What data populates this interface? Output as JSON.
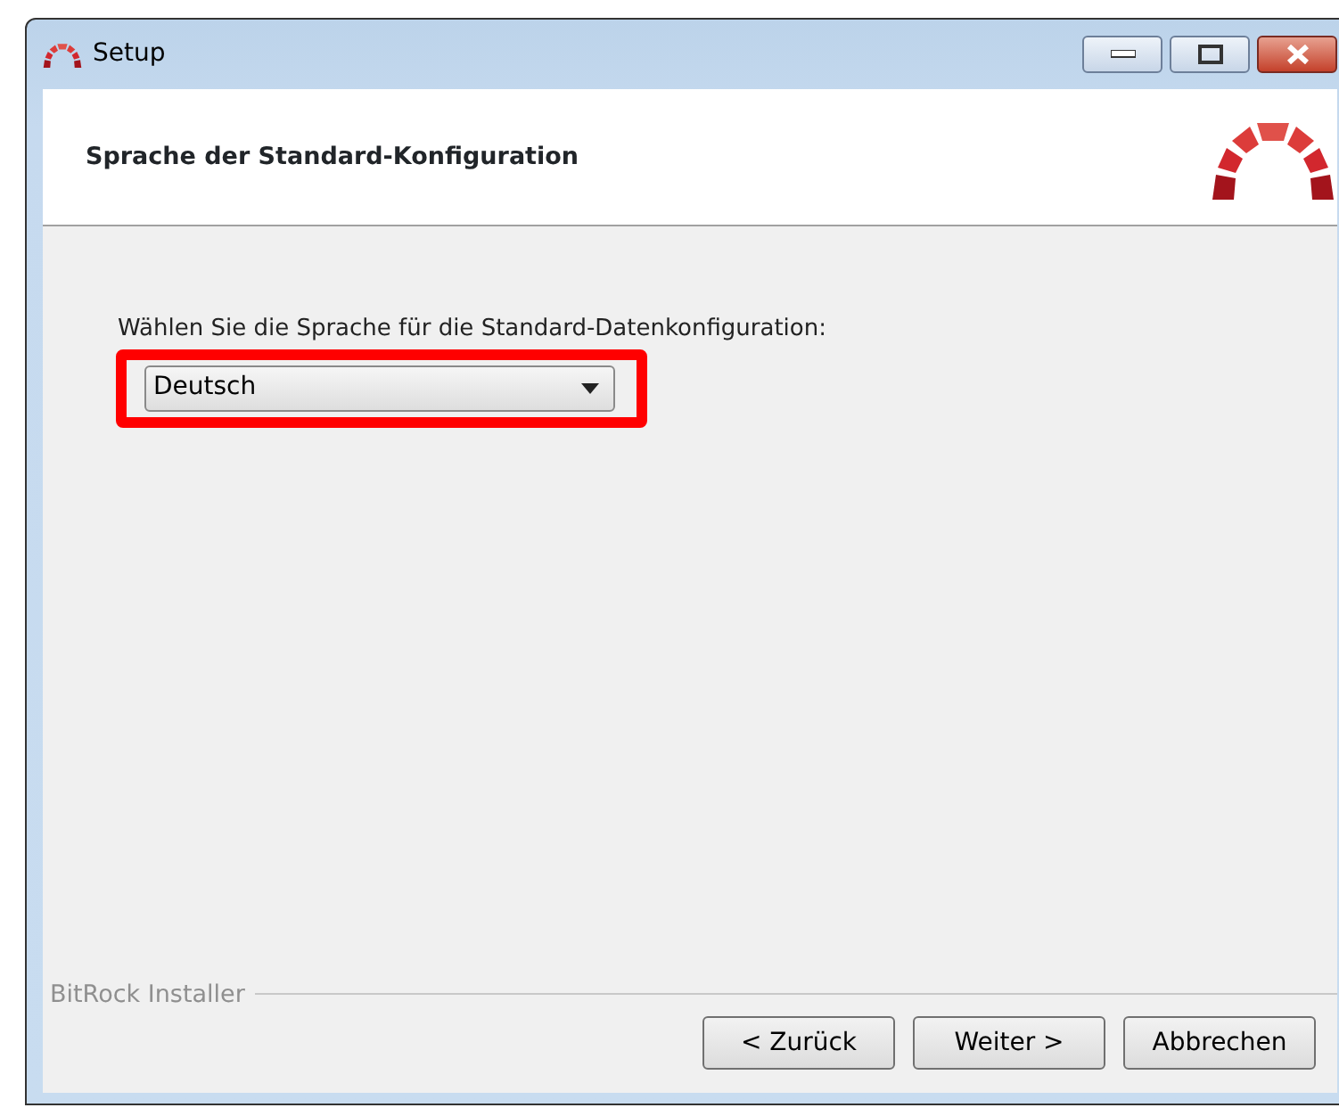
{
  "window": {
    "title": "Setup"
  },
  "header": {
    "title": "Sprache der Standard-Konfiguration"
  },
  "language": {
    "label": "Wählen Sie die Sprache für die Standard-Datenkonfiguration:",
    "value": "Deutsch",
    "highlighted": true
  },
  "footer": {
    "brand": "BitRock Installer"
  },
  "buttons": [
    {
      "label": "< Zurück"
    },
    {
      "label": "Weiter >"
    },
    {
      "label": "Abbrechen"
    }
  ]
}
